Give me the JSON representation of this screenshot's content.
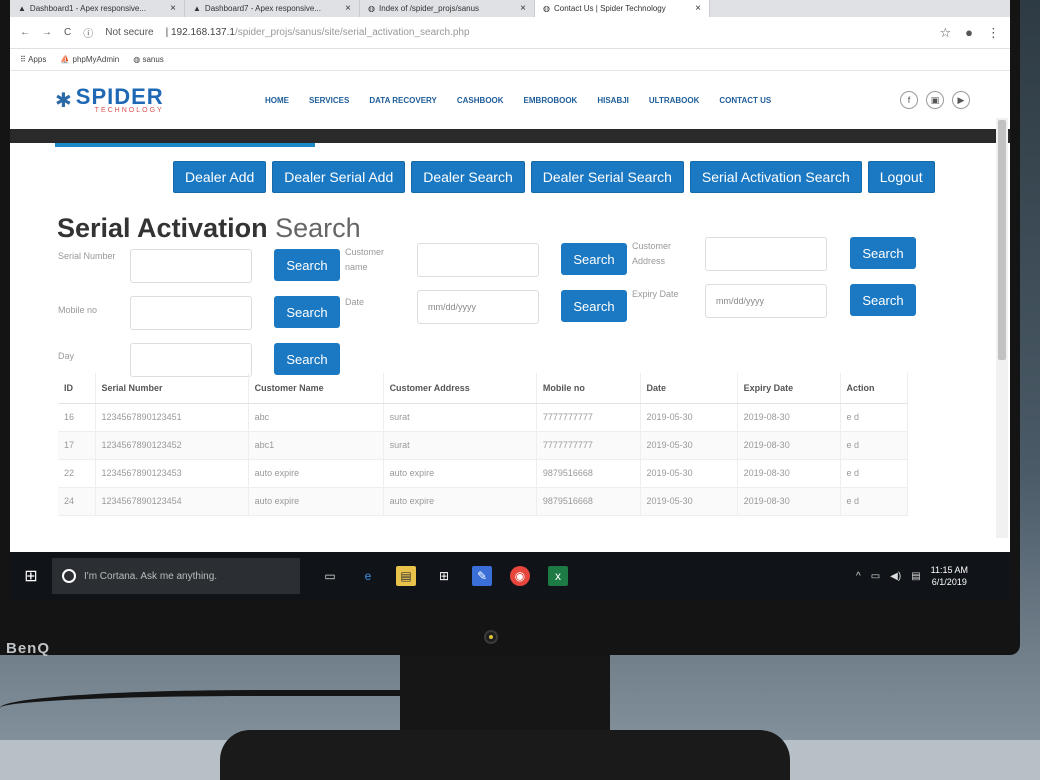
{
  "monitor": {
    "brand": "BenQ"
  },
  "browser": {
    "tabs": [
      {
        "title": "Dashboard1 - Apex responsive...",
        "active": false
      },
      {
        "title": "Dashboard7 - Apex responsive...",
        "active": false
      },
      {
        "title": "Index of /spider_projs/sanus",
        "active": false
      },
      {
        "title": "Contact Us | Spider Technology",
        "active": true
      }
    ],
    "security": "Not secure",
    "url_host": "192.168.137.1",
    "url_path": "/spider_projs/sanus/site/serial_activation_search.php",
    "bookmarks": [
      "Apps",
      "phpMyAdmin",
      "sanus"
    ]
  },
  "site": {
    "logo_name": "SPIDER",
    "logo_sub": "TECHNOLOGY",
    "menu": [
      "HOME",
      "SERVICES",
      "DATA RECOVERY",
      "CASHBOOK",
      "EMBROBOOK",
      "HISABJI",
      "ULTRABOOK",
      "CONTACT US"
    ],
    "social": [
      "f",
      "▣",
      "▶"
    ]
  },
  "actions": [
    "Dealer Add",
    "Dealer Serial Add",
    "Dealer Search",
    "Dealer Serial Search",
    "Serial Activation Search",
    "Logout"
  ],
  "title": {
    "bold": "Serial Activation",
    "light": "Search"
  },
  "form": {
    "serial_label": "Serial Number",
    "customer_label": "Customer name",
    "address_label": "Customer Address",
    "mobile_label": "Mobile no",
    "date_label": "Date",
    "date_placeholder": "mm/dd/yyyy",
    "expiry_label": "Expiry Date",
    "expiry_placeholder": "mm/dd/yyyy",
    "day_label": "Day",
    "search_label": "Search"
  },
  "table": {
    "headers": [
      "ID",
      "Serial Number",
      "Customer Name",
      "Customer Address",
      "Mobile no",
      "Date",
      "Expiry Date",
      "Action"
    ],
    "rows": [
      [
        "16",
        "1234567890123451",
        "abc",
        "surat",
        "7777777777",
        "2019-05-30",
        "2019-08-30",
        "e d"
      ],
      [
        "17",
        "1234567890123452",
        "abc1",
        "surat",
        "7777777777",
        "2019-05-30",
        "2019-08-30",
        "e d"
      ],
      [
        "22",
        "1234567890123453",
        "auto expire",
        "auto expire",
        "9879516668",
        "2019-05-30",
        "2019-08-30",
        "e d"
      ],
      [
        "24",
        "1234567890123454",
        "auto expire",
        "auto expire",
        "9879516668",
        "2019-05-30",
        "2019-08-30",
        "e d"
      ]
    ]
  },
  "taskbar": {
    "cortana": "I'm Cortana. Ask me anything.",
    "time": "11:15 AM",
    "date": "6/1/2019"
  }
}
